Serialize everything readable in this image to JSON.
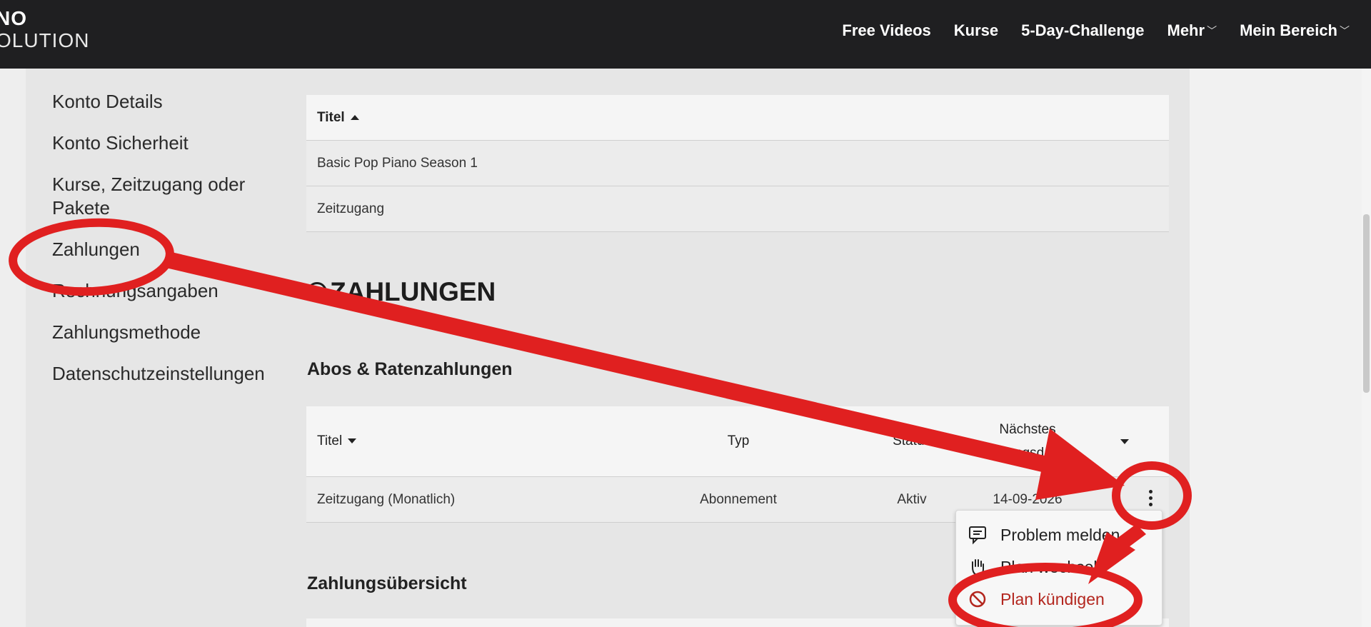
{
  "header": {
    "logo_line1": "NO",
    "logo_line2": "OLUTION",
    "nav": [
      {
        "label": "Free Videos"
      },
      {
        "label": "Kurse"
      },
      {
        "label": "5-Day-Challenge"
      },
      {
        "label": "Mehr"
      },
      {
        "label": "Mein Bereich"
      }
    ]
  },
  "sidebar": {
    "items": [
      {
        "label": "Konto Details"
      },
      {
        "label": "Konto Sicherheit"
      },
      {
        "label": "Kurse, Zeitzugang oder Pakete"
      },
      {
        "label": "Zahlungen"
      },
      {
        "label": "Rechnungsangaben"
      },
      {
        "label": "Zahlungsmethode"
      },
      {
        "label": "Datenschutzeinstellungen"
      }
    ]
  },
  "products_table": {
    "header": "Titel",
    "rows": [
      "Basic Pop Piano Season 1",
      "Zeitzugang"
    ]
  },
  "payments": {
    "title": "ZAHLUNGEN",
    "subscriptions_title": "Abos & Ratenzahlungen",
    "columns": {
      "title": "Titel",
      "type": "Typ",
      "status": "Status",
      "next_date_line1": "Nächstes",
      "next_date_line2": "Zahlungsdatum"
    },
    "rows": [
      {
        "title": "Zeitzugang (Monatlich)",
        "type": "Abonnement",
        "status": "Aktiv",
        "next_date": "14-09-2026"
      }
    ],
    "overview_title": "Zahlungsübersicht"
  },
  "context_menu": {
    "items": [
      {
        "label": "Problem melden",
        "icon": "message-icon"
      },
      {
        "label": "Plan wechseln",
        "icon": "hand-icon"
      },
      {
        "label": "Plan kündigen",
        "icon": "ban-icon",
        "color": "#b3261e"
      }
    ]
  },
  "annotation": {
    "color": "#e02020"
  }
}
